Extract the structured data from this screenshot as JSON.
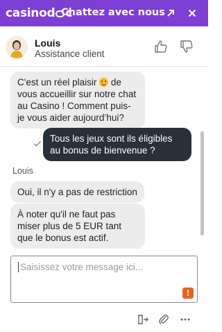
{
  "header": {
    "brand": "casinod",
    "brand_suffix": "c",
    "title": "Chattez avec nous",
    "expand_icon": "arrow-up-right-icon",
    "close_icon": "close-icon",
    "background": "#7b3fd4"
  },
  "agent": {
    "name": "Louis",
    "role": "Assistance client",
    "avatar_icon": "agent-avatar-icon"
  },
  "rating": {
    "up_icon": "thumbs-up-icon",
    "down_icon": "thumbs-down-icon"
  },
  "messages": [
    {
      "sender": "agent",
      "text_before_emoji": "C'est un réel plaisir",
      "emoji": "smiling-face-icon",
      "text_after_emoji": " de vous accueillir sur notre chat au Casino ! Comment puis-je vous aider aujourd’hui?"
    },
    {
      "sender": "user",
      "text": "Tous les jeux sont ils éligibles au bonus de bienvenue ?",
      "status_icon": "read-check-icon"
    },
    {
      "sender_label": "Louis"
    },
    {
      "sender": "agent",
      "text": "Oui, il n'y a pas de restriction"
    },
    {
      "sender": "agent",
      "text": "À noter qu'il ne faut pas miser plus de 5 EUR tant que le bonus est actif."
    }
  ],
  "composer": {
    "placeholder": "Saisissez votre message ici...",
    "value": "",
    "alert_badge": "!"
  },
  "footer": {
    "transfer_icon": "transfer-icon",
    "attach_icon": "paperclip-icon",
    "more_icon": "more-options-icon"
  },
  "colors": {
    "accent": "#7b3fd4",
    "user_bubble": "#283039",
    "agent_bubble": "#ececec",
    "alert": "#e8641c"
  }
}
